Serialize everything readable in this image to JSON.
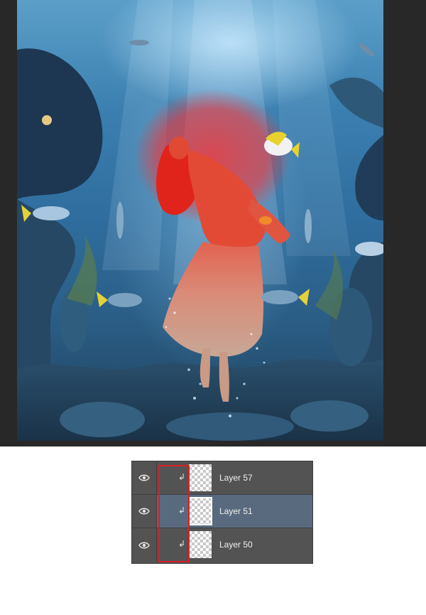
{
  "canvas": {
    "description_icon": "image-canvas",
    "mask_overlay_color": "#ff2020"
  },
  "layers_panel": {
    "layers": [
      {
        "name": "Layer 57",
        "selected": false,
        "eye_icon": "eye-icon",
        "clip_icon": "clipping-arrow-icon"
      },
      {
        "name": "Layer 51",
        "selected": true,
        "eye_icon": "eye-icon",
        "clip_icon": "clipping-arrow-icon"
      },
      {
        "name": "Layer 50",
        "selected": false,
        "eye_icon": "eye-icon",
        "clip_icon": "clipping-arrow-icon"
      }
    ],
    "clip_glyph": "↲",
    "highlight_color": "#d91f26",
    "selected_row_color": "#596a7f"
  }
}
